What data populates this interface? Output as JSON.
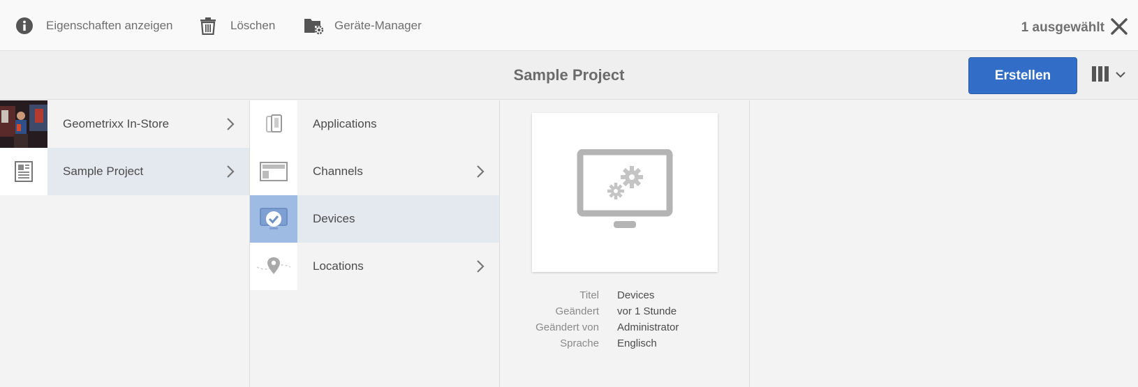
{
  "actionbar": {
    "actions": [
      {
        "label": "Eigenschaften anzeigen",
        "icon": "info-icon"
      },
      {
        "label": "Löschen",
        "icon": "trash-icon"
      },
      {
        "label": "Geräte-Manager",
        "icon": "folder-gear-icon"
      }
    ],
    "selection_count": "1 ausgewählt",
    "close_icon": "close-icon"
  },
  "titlebar": {
    "title": "Sample Project",
    "create_label": "Erstellen",
    "view_switch_icon": "column-view-icon"
  },
  "columns": {
    "col1": [
      {
        "label": "Geometrixx In-Store",
        "has_children": true,
        "active": false,
        "thumb": "photo"
      },
      {
        "label": "Sample Project",
        "has_children": true,
        "active": true,
        "thumb": "document-icon"
      }
    ],
    "col2": [
      {
        "label": "Applications",
        "has_children": false,
        "active": false,
        "thumb": "devices-icon"
      },
      {
        "label": "Channels",
        "has_children": true,
        "active": false,
        "thumb": "layout-icon"
      },
      {
        "label": "Devices",
        "has_children": false,
        "active": true,
        "selected": true,
        "thumb": "monitor-check-icon"
      },
      {
        "label": "Locations",
        "has_children": true,
        "active": false,
        "thumb": "location-pin-icon"
      }
    ]
  },
  "preview": {
    "icon": "monitor-gears-icon",
    "meta": [
      {
        "key": "Titel",
        "value": "Devices"
      },
      {
        "key": "Geändert",
        "value": "vor 1 Stunde"
      },
      {
        "key": "Geändert von",
        "value": "Administrator"
      },
      {
        "key": "Sprache",
        "value": "Englisch"
      }
    ]
  },
  "colors": {
    "accent": "#326ec8",
    "active_row": "#e4e8ef",
    "selected_thumb": "#9dbbe3"
  }
}
